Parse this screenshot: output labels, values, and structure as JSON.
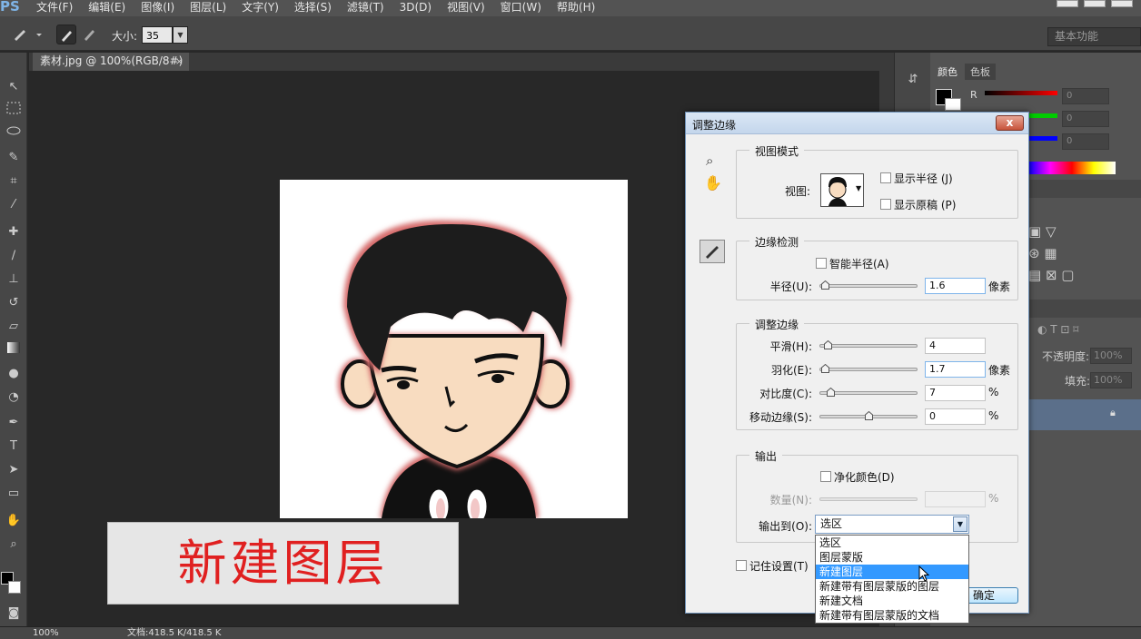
{
  "app": {
    "logo": "PS",
    "menus": [
      "文件(F)",
      "编辑(E)",
      "图像(I)",
      "图层(L)",
      "文字(Y)",
      "选择(S)",
      "滤镜(T)",
      "3D(D)",
      "视图(V)",
      "窗口(W)",
      "帮助(H)"
    ]
  },
  "options_bar": {
    "size_label": "大小:",
    "size_value": "35",
    "workspace": "基本功能"
  },
  "document_tab": {
    "title": "素材.jpg @ 100%(RGB/8#)",
    "close": "×"
  },
  "status_bar": {
    "zoom": "100%",
    "doc_info": "文档:418.5 K/418.5 K"
  },
  "right_panel": {
    "tab_color": "颜色",
    "tab_swatches": "色板",
    "channel_r": "R",
    "value_r": "0",
    "value_g": "0",
    "value_b": "0",
    "opacity_label": "不透明度:",
    "opacity_value": "100%",
    "fill_label": "填充:",
    "fill_value": "100%"
  },
  "caption": "新建图层",
  "dialog": {
    "title": "调整边缘",
    "close": "x",
    "view_mode": {
      "legend": "视图模式",
      "view_label": "视图:",
      "show_radius": "显示半径 (J)",
      "show_original": "显示原稿 (P)"
    },
    "edge_detection": {
      "legend": "边缘检测",
      "smart_radius": "智能半径(A)",
      "radius_label": "半径(U):",
      "radius_value": "1.6",
      "radius_unit": "像素"
    },
    "adjust_edge": {
      "legend": "调整边缘",
      "smooth_label": "平滑(H):",
      "smooth_value": "4",
      "feather_label": "羽化(E):",
      "feather_value": "1.7",
      "feather_unit": "像素",
      "contrast_label": "对比度(C):",
      "contrast_value": "7",
      "contrast_unit": "%",
      "shift_label": "移动边缘(S):",
      "shift_value": "0",
      "shift_unit": "%"
    },
    "output": {
      "legend": "输出",
      "decontaminate": "净化颜色(D)",
      "amount_label": "数量(N):",
      "amount_unit": "%",
      "output_to_label": "输出到(O):",
      "output_to_value": "选区",
      "options": [
        "选区",
        "图层蒙版",
        "新建图层",
        "新建带有图层蒙版的图层",
        "新建文档",
        "新建带有图层蒙版的文档"
      ],
      "selected_index": 2
    },
    "remember": "记住设置(T)",
    "ok_label": "确定"
  }
}
